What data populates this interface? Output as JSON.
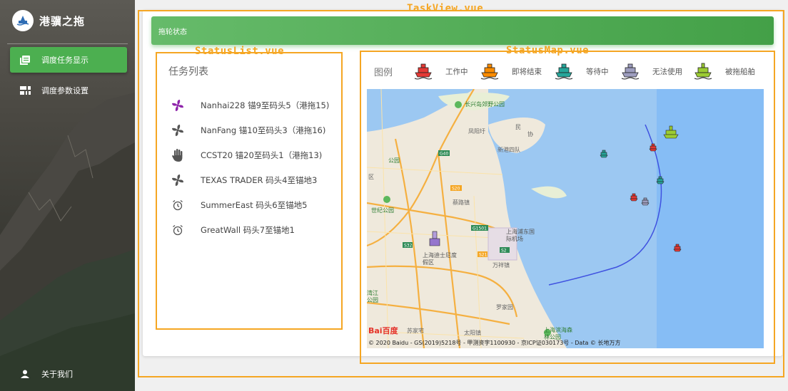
{
  "app": {
    "title": "港骥之拖"
  },
  "nav": {
    "items": [
      {
        "label": "调度任务显示",
        "icon": "list-icon"
      },
      {
        "label": "调度参数设置",
        "icon": "settings-panel-icon"
      }
    ],
    "about": "关于我们"
  },
  "dev_labels": {
    "taskview": "TaskView.vue",
    "statuslist": "StatusList.vue",
    "statusmap": "StatusMap.vue"
  },
  "header": {
    "title": "拖轮状态"
  },
  "task_list": {
    "title": "任务列表",
    "items": [
      {
        "text": "Nanhai228 锚9至码头5（港拖15)",
        "icon": "fan-icon",
        "color": "#8e24aa"
      },
      {
        "text": "NanFang 锚10至码头3（港拖16)",
        "icon": "fan-icon",
        "color": "#555555"
      },
      {
        "text": "CCST20 锚20至码头1（港拖13)",
        "icon": "hand-icon",
        "color": "#555555"
      },
      {
        "text": "TEXAS TRADER 码头4至锚地3",
        "icon": "fan-icon",
        "color": "#555555"
      },
      {
        "text": "SummerEast 码头6至锚地5",
        "icon": "alarm-clock-icon",
        "color": "#555555"
      },
      {
        "text": "GreatWall 码头7至锚地1",
        "icon": "alarm-clock-icon",
        "color": "#555555"
      }
    ]
  },
  "legend": {
    "title": "图例",
    "items": [
      {
        "label": "工作中",
        "color": "#e53935"
      },
      {
        "label": "即将结束",
        "color": "#fb8c00"
      },
      {
        "label": "等待中",
        "color": "#26a69a"
      },
      {
        "label": "无法使用",
        "color": "#9e9ebf"
      },
      {
        "label": "被拖船舶",
        "color": "#9ccc33"
      }
    ]
  },
  "map": {
    "labels": {
      "changxing": "长兴岛郊野公园",
      "fengyang": "凤阳圩",
      "minzhu": "民",
      "xiexie": "协",
      "xingang": "新港四队",
      "g40": "G40",
      "park1": "公园",
      "s20": "S20",
      "qu": "区",
      "shijigongyuan": "世纪公园",
      "caolu": "蔡路镇",
      "g1501": "G1501",
      "airport": "上海浦东国际机场",
      "s2": "S2",
      "disney": "上海迪士尼度假区",
      "s32": "S32",
      "s21": "S21",
      "zhuqiao": "万祥镇",
      "jiangwan": "湾江公园",
      "luojiayuan": "罗家园",
      "shanghai_forest": "上海滨海森林公园",
      "jiazhai": "苏家宅",
      "taiyang": "太阳镇"
    },
    "copyright": "© 2020 Baidu - GS(2019)5218号 - 甲测资字1100930 - 京ICP证030173号 - Data © 长地万方",
    "brand": "Bai百度"
  }
}
